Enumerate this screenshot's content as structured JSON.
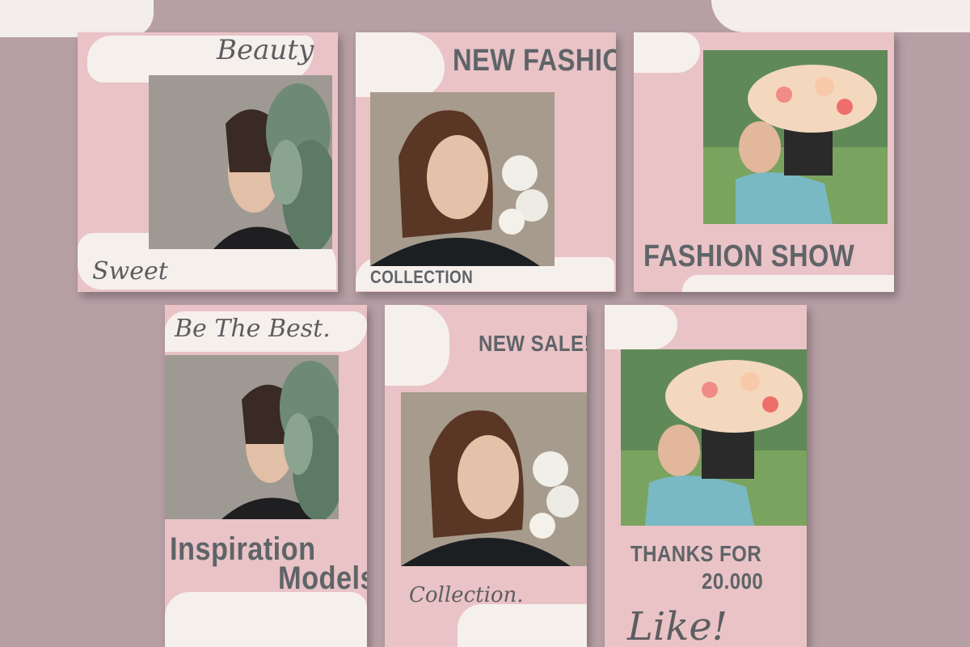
{
  "cards": {
    "beauty": {
      "title": "Beauty",
      "footer": "Sweet"
    },
    "new_fashion": {
      "title": "NEW FASHION",
      "footer": "COLLECTION"
    },
    "fashion_show": {
      "title": "FASHION SHOW"
    },
    "be_the_best": {
      "title": "Be The Best.",
      "line1": "Inspiration",
      "line2": "Models"
    },
    "new_sale": {
      "title": "NEW SALE!",
      "footer": "Collection."
    },
    "thanks": {
      "line1": "THANKS FOR",
      "line2": "20.000",
      "script": "Like!"
    }
  },
  "colors": {
    "background": "#b79fa6",
    "card": "#e9c3c6",
    "brush": "#f6f1ee",
    "text": "#5f6468"
  }
}
